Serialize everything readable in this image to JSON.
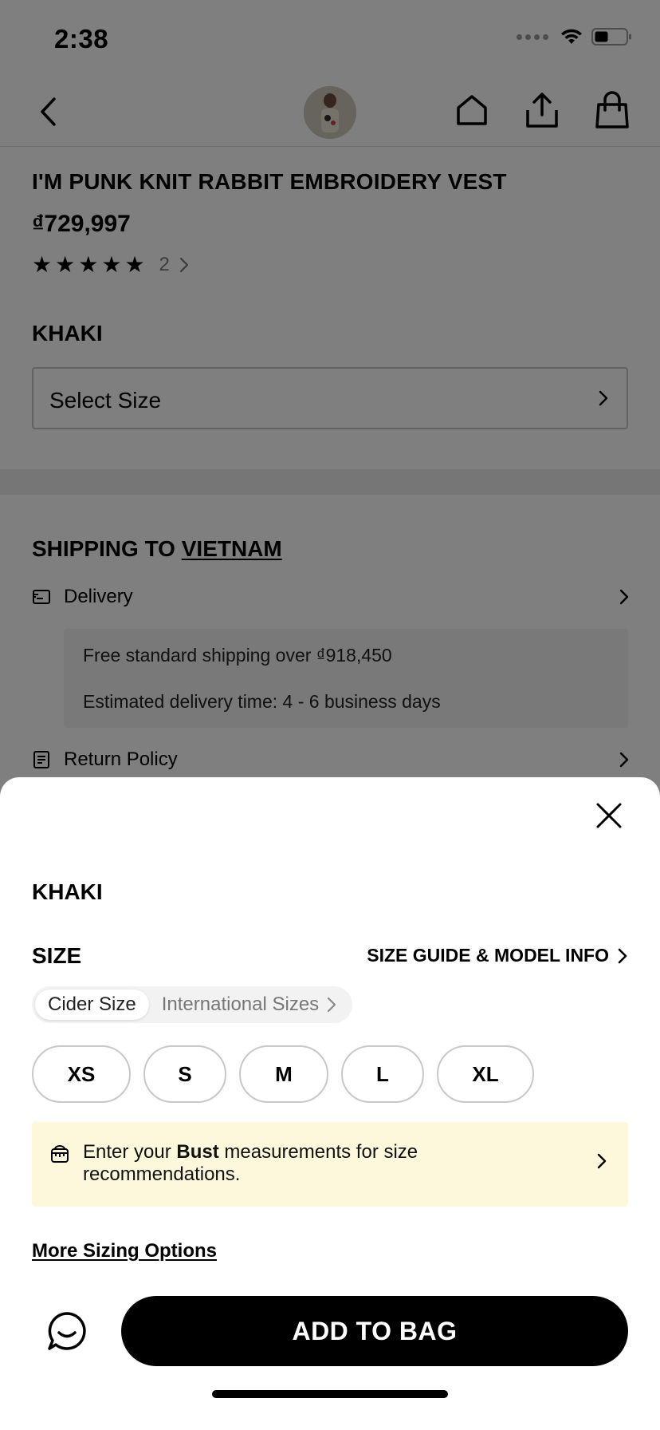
{
  "status_bar": {
    "time": "2:38"
  },
  "product": {
    "title": "I'M PUNK KNIT RABBIT EMBROIDERY VEST",
    "price": "₫729,997",
    "rating": {
      "stars": 5,
      "count": "2"
    },
    "color": "KHAKI",
    "select_size_placeholder": "Select Size"
  },
  "shipping": {
    "title_prefix": "SHIPPING TO ",
    "country": "VIETNAM",
    "delivery_label": "Delivery",
    "free_shipping": "Free standard shipping over ₫918,450",
    "estimated_time": "Estimated delivery time: 4 - 6 business days",
    "return_label": "Return Policy"
  },
  "sheet": {
    "color": "KHAKI",
    "size_label": "SIZE",
    "size_guide_label": "SIZE GUIDE & MODEL INFO",
    "size_types": [
      "Cider Size",
      "International Sizes"
    ],
    "active_size_type": "Cider Size",
    "sizes": [
      "XS",
      "S",
      "M",
      "L",
      "XL"
    ],
    "measure_prefix": "Enter your ",
    "measure_bold": "Bust",
    "measure_suffix": " measurements for size recommendations.",
    "more_sizing": "More Sizing Options",
    "add_to_bag": "ADD TO BAG"
  },
  "colors": {
    "accent": "#000000",
    "banner_bg": "#fdf8dc",
    "overlay": "rgba(0,0,0,0.5)"
  },
  "icons": [
    "back-icon",
    "home-icon",
    "share-icon",
    "bag-icon",
    "star-icon",
    "chevron-right-icon",
    "delivery-icon",
    "return-policy-icon",
    "close-icon",
    "measure-icon",
    "chat-icon"
  ]
}
